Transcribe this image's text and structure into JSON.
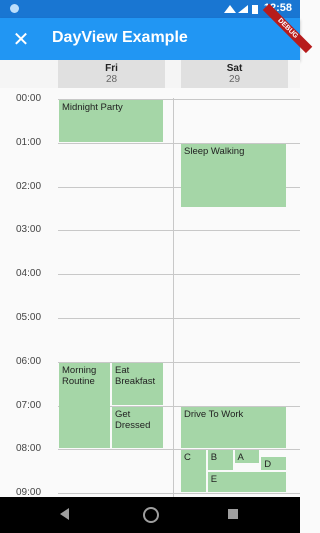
{
  "status": {
    "time": "12:58"
  },
  "appbar": {
    "title": "DayView Example",
    "close_icon": "close-icon",
    "debug_banner": "DEBUG"
  },
  "days": [
    {
      "name": "Fri",
      "date": "28"
    },
    {
      "name": "Sat",
      "date": "29"
    }
  ],
  "times": [
    "00:00",
    "01:00",
    "02:00",
    "03:00",
    "04:00",
    "05:00",
    "06:00",
    "07:00",
    "08:00",
    "09:00"
  ],
  "events": [
    {
      "title": "Midnight Party",
      "day": 0,
      "start": 0.0,
      "end": 1.0,
      "col": 0,
      "cols": 1,
      "span": 1
    },
    {
      "title": "Sleep Walking",
      "day": 1,
      "start": 1.0,
      "end": 2.5,
      "col": 0,
      "cols": 1,
      "span": 1
    },
    {
      "title": "Morning Routine",
      "day": 0,
      "start": 6.0,
      "end": 8.0,
      "col": 0,
      "cols": 2,
      "span": 1
    },
    {
      "title": "Eat Breakfast",
      "day": 0,
      "start": 6.0,
      "end": 7.0,
      "col": 1,
      "cols": 2,
      "span": 1
    },
    {
      "title": "Get Dressed",
      "day": 0,
      "start": 7.0,
      "end": 8.0,
      "col": 1,
      "cols": 2,
      "span": 1
    },
    {
      "title": "Drive To Work",
      "day": 1,
      "start": 7.0,
      "end": 8.0,
      "col": 0,
      "cols": 1,
      "span": 1
    },
    {
      "title": "C",
      "day": 1,
      "start": 8.0,
      "end": 9.0,
      "col": 0,
      "cols": 4,
      "span": 1
    },
    {
      "title": "B",
      "day": 1,
      "start": 8.0,
      "end": 8.5,
      "col": 1,
      "cols": 4,
      "span": 1
    },
    {
      "title": "A",
      "day": 1,
      "start": 8.0,
      "end": 8.33,
      "col": 2,
      "cols": 4,
      "span": 1
    },
    {
      "title": "D",
      "day": 1,
      "start": 8.15,
      "end": 8.5,
      "col": 3,
      "cols": 4,
      "span": 1
    },
    {
      "title": "E",
      "day": 1,
      "start": 8.5,
      "end": 9.0,
      "col": 1,
      "cols": 4,
      "span": 3
    }
  ],
  "colors": {
    "event": "#a5d6a7",
    "appbar": "#2196f3",
    "statusbar": "#1976d2"
  }
}
